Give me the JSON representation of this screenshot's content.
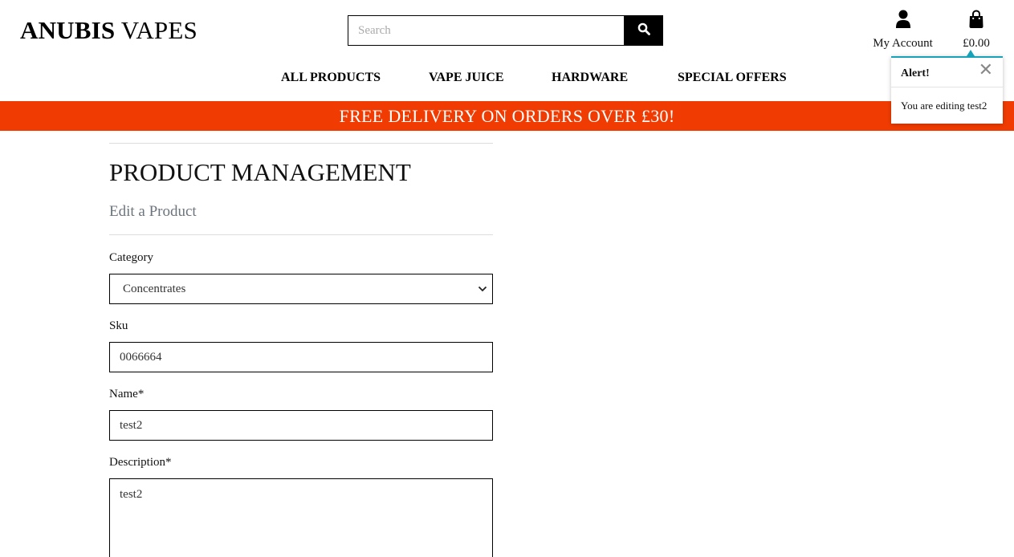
{
  "brand": {
    "name_bold": "ANUBIS",
    "name_rest": "VAPES"
  },
  "search": {
    "placeholder": "Search",
    "icon": "search-icon"
  },
  "account": {
    "label": "My Account",
    "icon": "user-icon"
  },
  "bag": {
    "total": "£0.00",
    "icon": "shopping-bag-icon"
  },
  "nav": {
    "items": [
      "ALL PRODUCTS",
      "VAPE JUICE",
      "HARDWARE",
      "SPECIAL OFFERS"
    ]
  },
  "banner": {
    "text": "FREE DELIVERY ON ORDERS OVER £30!"
  },
  "colors": {
    "banner": "#f03c02",
    "toast_accent": "#17a2b8"
  },
  "toast": {
    "title": "Alert!",
    "message": "You are editing test2"
  },
  "page": {
    "title": "PRODUCT MANAGEMENT",
    "subtitle": "Edit a Product",
    "form": {
      "category": {
        "label": "Category",
        "value": "Concentrates"
      },
      "sku": {
        "label": "Sku",
        "value": "0066664"
      },
      "name": {
        "label": "Name*",
        "value": "test2"
      },
      "description": {
        "label": "Description*",
        "value": "test2"
      }
    }
  }
}
